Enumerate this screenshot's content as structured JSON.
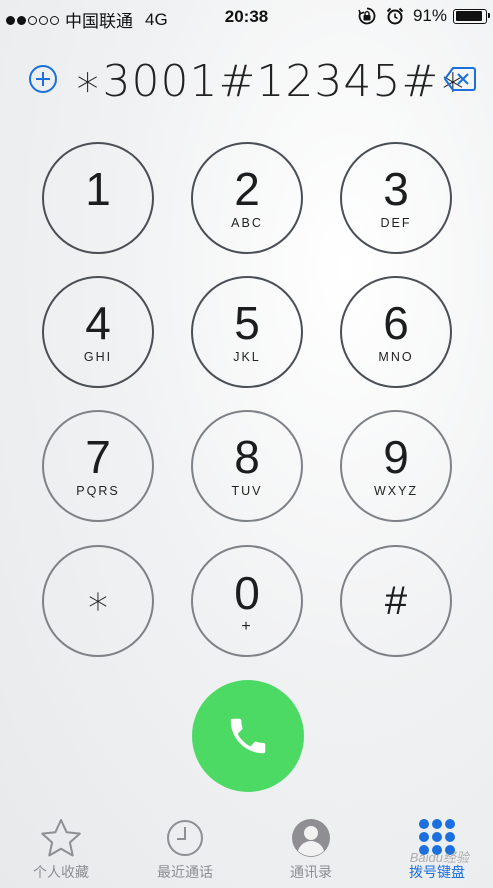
{
  "status_bar": {
    "carrier": "中国联通",
    "network": "4G",
    "time": "20:38",
    "battery_percent": "91%",
    "battery_level": 0.91,
    "signal_bars": 2
  },
  "display": {
    "number": "∗3001#12345#∗"
  },
  "keypad": [
    {
      "digit": "1",
      "letters": ""
    },
    {
      "digit": "2",
      "letters": "ABC"
    },
    {
      "digit": "3",
      "letters": "DEF"
    },
    {
      "digit": "4",
      "letters": "GHI"
    },
    {
      "digit": "5",
      "letters": "JKL"
    },
    {
      "digit": "6",
      "letters": "MNO"
    },
    {
      "digit": "7",
      "letters": "PQRS"
    },
    {
      "digit": "8",
      "letters": "TUV"
    },
    {
      "digit": "9",
      "letters": "WXYZ"
    },
    {
      "digit": "∗",
      "letters": ""
    },
    {
      "digit": "0",
      "letters": "+"
    },
    {
      "digit": "#",
      "letters": ""
    }
  ],
  "tabs": [
    {
      "label": "个人收藏",
      "icon": "star-icon"
    },
    {
      "label": "最近通话",
      "icon": "clock-icon"
    },
    {
      "label": "通讯录",
      "icon": "contacts-icon"
    },
    {
      "label": "拨号键盘",
      "icon": "keypad-icon",
      "active": true
    }
  ],
  "colors": {
    "call_green": "#4cd964",
    "active_blue": "#1b6fde",
    "inactive_gray": "#8e8e93"
  },
  "watermark": "Baidu经验"
}
